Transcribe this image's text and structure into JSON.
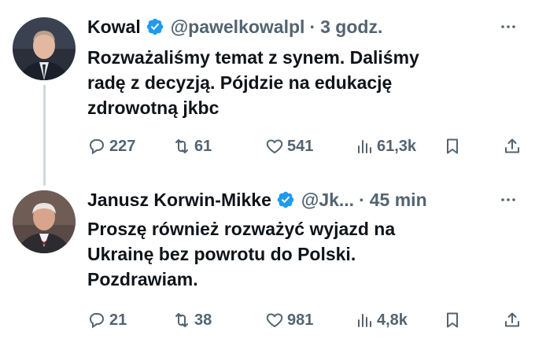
{
  "tweets": [
    {
      "name": "Kowal",
      "handle": "@pawelkowalpl",
      "separator": "·",
      "time": "3 godz.",
      "text_lines": [
        "Rozważaliśmy temat z synem. Daliśmy",
        "radę z decyzją. Pójdzie na edukację",
        "zdrowotną jkbc"
      ],
      "replies": "227",
      "retweets": "61",
      "likes": "541",
      "views": "61,3k"
    },
    {
      "name": "Janusz Korwin-Mikke",
      "handle": "@Jk...",
      "separator": "·",
      "time": "45 min",
      "text_lines": [
        "Proszę również rozważyć wyjazd na",
        "Ukrainę bez powrotu do Polski.",
        "Pozdrawiam."
      ],
      "replies": "21",
      "retweets": "38",
      "likes": "981",
      "views": "4,8k"
    }
  ],
  "icons": {
    "verified": "verified-badge-icon",
    "more": "more-dots-icon",
    "reply": "reply-icon",
    "retweet": "retweet-icon",
    "like": "heart-icon",
    "views": "views-chart-icon",
    "bookmark": "bookmark-icon",
    "share": "share-icon"
  },
  "colors": {
    "text": "#0f1419",
    "secondary": "#536471",
    "verified": "#1d9bf0",
    "thread_line": "#cfd9de"
  }
}
